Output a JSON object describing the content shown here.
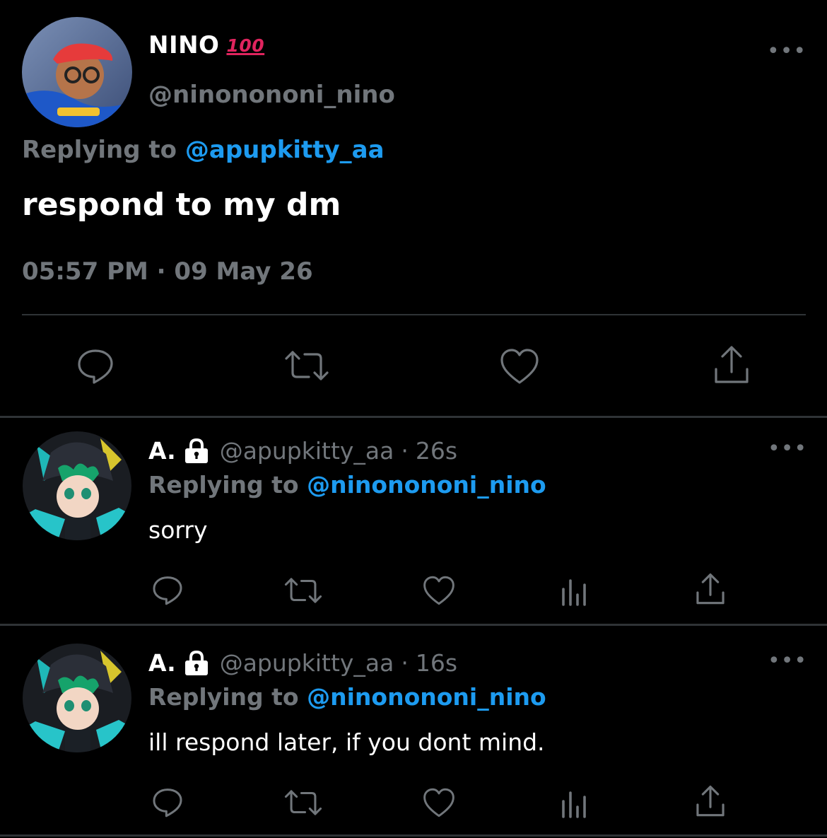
{
  "main_tweet": {
    "display_name": "NINO",
    "name_emoji": "100",
    "handle": "@ninonononi_nino",
    "more_label": "•••",
    "replying_prefix": "Replying to",
    "replying_handle": "@apupkitty_aa",
    "text": "respond to my dm",
    "timestamp": "05:57 PM · 09 May 26",
    "actions": [
      "reply-icon",
      "retweet-icon",
      "like-icon",
      "share-icon"
    ]
  },
  "replies": [
    {
      "display_name": "A.",
      "handle": "@apupkitty_aa",
      "separator": "·",
      "time": "26s",
      "more_label": "•••",
      "replying_prefix": "Replying to",
      "replying_handle": "@ninonononi_nino",
      "text": "sorry",
      "actions": [
        "reply-icon",
        "retweet-icon",
        "like-icon",
        "analytics-icon",
        "share-icon"
      ]
    },
    {
      "display_name": "A.",
      "handle": "@apupkitty_aa",
      "separator": "·",
      "time": "16s",
      "more_label": "•••",
      "replying_prefix": "Replying to",
      "replying_handle": "@ninonononi_nino",
      "text": "ill respond later, if you dont mind.",
      "actions": [
        "reply-icon",
        "retweet-icon",
        "like-icon",
        "analytics-icon",
        "share-icon"
      ]
    }
  ],
  "colors": {
    "background": "#000000",
    "text": "#ffffff",
    "muted": "#71767b",
    "link": "#1d9bf0",
    "divider": "#2f3336",
    "emoji_red": "#e0245e"
  }
}
